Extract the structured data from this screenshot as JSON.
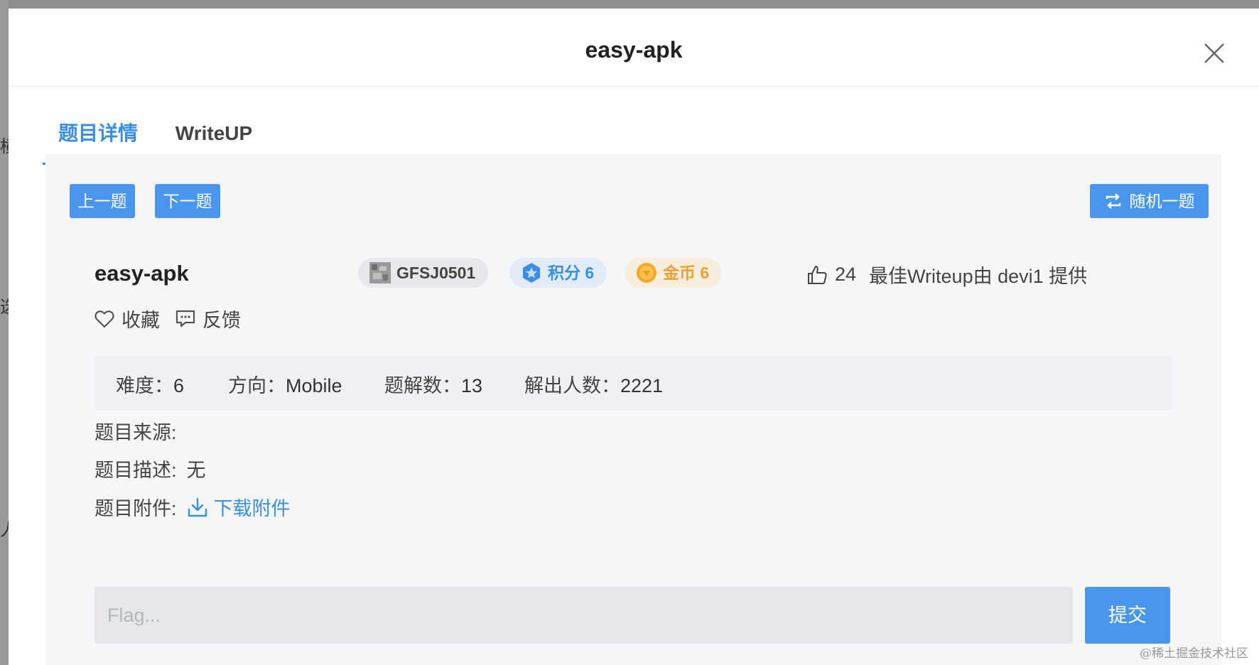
{
  "modal": {
    "title": "easy-apk"
  },
  "tabs": [
    {
      "label": "题目详情",
      "active": true
    },
    {
      "label": "WriteUP",
      "active": false
    }
  ],
  "nav": {
    "prev_label": "上一题",
    "next_label": "下一题",
    "random_label": "随机一题"
  },
  "problem": {
    "name": "easy-apk",
    "author": "GFSJ0501",
    "score_label": "积分 6",
    "gold_label": "金币 6",
    "likes": "24",
    "best_writeup": "最佳Writeup由 devi1 提供",
    "favorite_label": "收藏",
    "feedback_label": "反馈"
  },
  "stats": [
    {
      "label": "难度：",
      "value": "6"
    },
    {
      "label": "方向：",
      "value": "Mobile"
    },
    {
      "label": "题解数：",
      "value": "13"
    },
    {
      "label": "解出人数：",
      "value": "2221"
    }
  ],
  "info": {
    "source_label": "题目来源:",
    "source_value": "",
    "desc_label": "题目描述:",
    "desc_value": "无",
    "attach_label": "题目附件:",
    "download_label": "下载附件"
  },
  "flag": {
    "placeholder": "Flag...",
    "value": "",
    "submit_label": "提交"
  },
  "backdrop": {
    "chars": [
      "横",
      "选",
      "人"
    ]
  },
  "watermark": "@稀土掘金技术社区",
  "colors": {
    "accent": "#4a96ee",
    "gold": "#f0a030",
    "panel": "#f3f5f7"
  }
}
